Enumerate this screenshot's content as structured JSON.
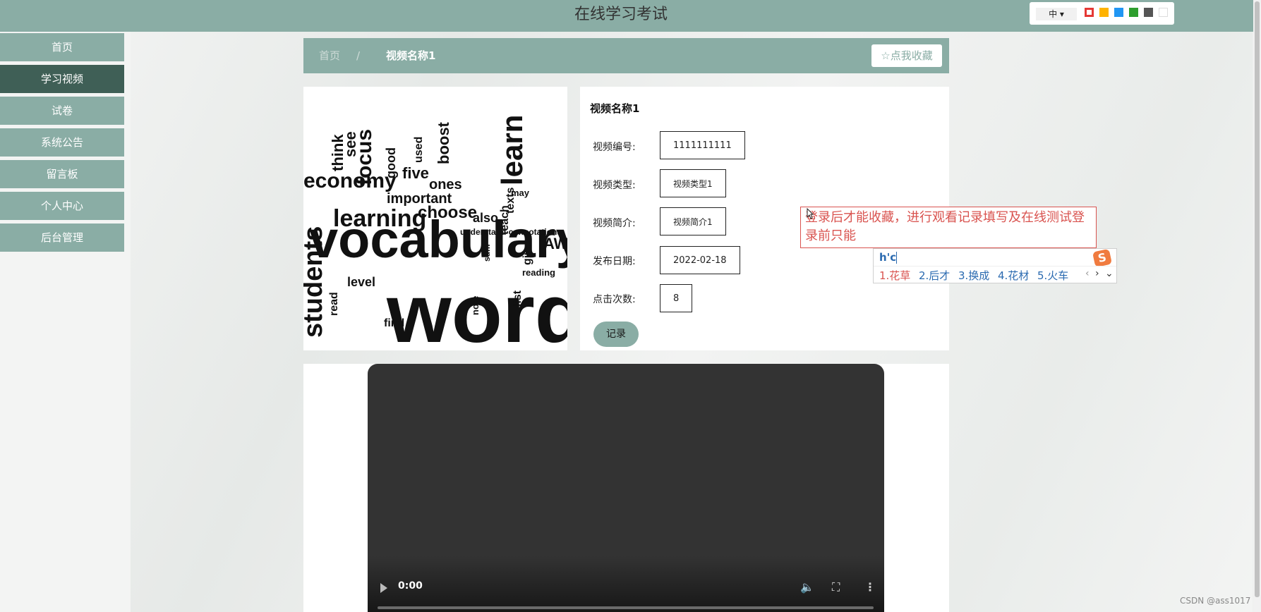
{
  "header": {
    "site_title": "在线学习考试",
    "ime_lang": "中 ▾",
    "theme_swatches": [
      "#e53935",
      "#ffb300",
      "#2196f3",
      "#2e9e2e",
      "#555555",
      "#ffffff"
    ]
  },
  "sidebar": {
    "items": [
      {
        "label": "首页"
      },
      {
        "label": "学习视频",
        "active": true
      },
      {
        "label": "试卷"
      },
      {
        "label": "系统公告"
      },
      {
        "label": "留言板"
      },
      {
        "label": "个人中心"
      },
      {
        "label": "后台管理"
      }
    ]
  },
  "breadcrumb": {
    "home": "首页",
    "separator": "/",
    "current": "视频名称1",
    "favorite_label": "点我收藏",
    "favorite_icon": "star-outline-icon"
  },
  "cover_words": [
    "vocabulary",
    "word",
    "learning",
    "economy",
    "focus",
    "students",
    "learn",
    "choose",
    "important",
    "boost",
    "five",
    "ones",
    "think",
    "see",
    "good",
    "used",
    "level",
    "read",
    "find",
    "list",
    "give",
    "reading",
    "teach",
    "texts",
    "sum",
    "note",
    "AWL",
    "also",
    "may",
    "understand connotations"
  ],
  "details": {
    "title": "视频名称1",
    "fields": [
      {
        "label": "视频编号:",
        "value": "1111111111"
      },
      {
        "label": "视频类型:",
        "value": "视频类型1"
      },
      {
        "label": "视频简介:",
        "value": "视频简介1"
      },
      {
        "label": "发布日期:",
        "value": "2022-02-18"
      },
      {
        "label": "点击次数:",
        "value": "8"
      }
    ],
    "record_label": "记录"
  },
  "tooltip": {
    "text": "登录后才能收藏，进行观看记录填写及在线测试登录前只能"
  },
  "ime_popup": {
    "input": "h'c",
    "candidates": [
      "1.花草",
      "2.后才",
      "3.换成",
      "4.花材",
      "5.火车"
    ],
    "logo": "S"
  },
  "video": {
    "time": "0:00",
    "progress": 0
  },
  "watermark": "CSDN @ass1017"
}
